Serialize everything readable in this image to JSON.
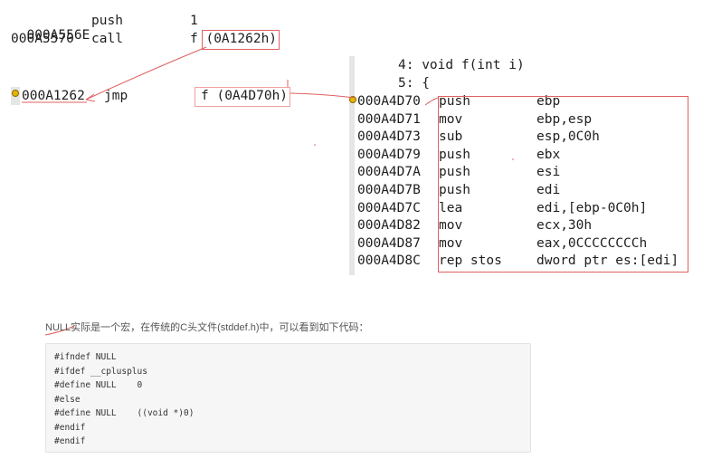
{
  "caller": [
    {
      "address": "000A556E",
      "mnemonic": "push",
      "operand": "1"
    },
    {
      "address": "000A5570",
      "mnemonic": "call",
      "operand": "f (0A1262h)"
    }
  ],
  "thunk": {
    "address": "000A1262",
    "mnemonic": "jmp",
    "operand": "f (0A4D70h)"
  },
  "source_lines": [
    "4: void f(int i)",
    "5: {"
  ],
  "disassembly": [
    {
      "address": "000A4D70",
      "mnemonic": "push",
      "operands": "ebp"
    },
    {
      "address": "000A4D71",
      "mnemonic": "mov",
      "operands": "ebp,esp"
    },
    {
      "address": "000A4D73",
      "mnemonic": "sub",
      "operands": "esp,0C0h"
    },
    {
      "address": "000A4D79",
      "mnemonic": "push",
      "operands": "ebx"
    },
    {
      "address": "000A4D7A",
      "mnemonic": "push",
      "operands": "esi"
    },
    {
      "address": "000A4D7B",
      "mnemonic": "push",
      "operands": "edi"
    },
    {
      "address": "000A4D7C",
      "mnemonic": "lea",
      "operands": "edi,[ebp-0C0h]"
    },
    {
      "address": "000A4D82",
      "mnemonic": "mov",
      "operands": "ecx,30h"
    },
    {
      "address": "000A4D87",
      "mnemonic": "mov",
      "operands": "eax,0CCCCCCCCh"
    },
    {
      "address": "000A4D8C",
      "mnemonic": "rep stos",
      "operands": "dword ptr es:[edi]"
    }
  ],
  "note": "NULL实际是一个宏，在传统的C头文件(stddef.h)中，可以看到如下代码：",
  "code_lines": [
    "#ifndef NULL",
    "#ifdef __cplusplus",
    "#define NULL    0",
    "#else",
    "#define NULL    ((void *)0)",
    "#endif",
    "#endif"
  ],
  "colors": {
    "annotation_red": "#e06060",
    "breakpoint": "#e8b400",
    "code_bg": "#f6f6f6"
  }
}
